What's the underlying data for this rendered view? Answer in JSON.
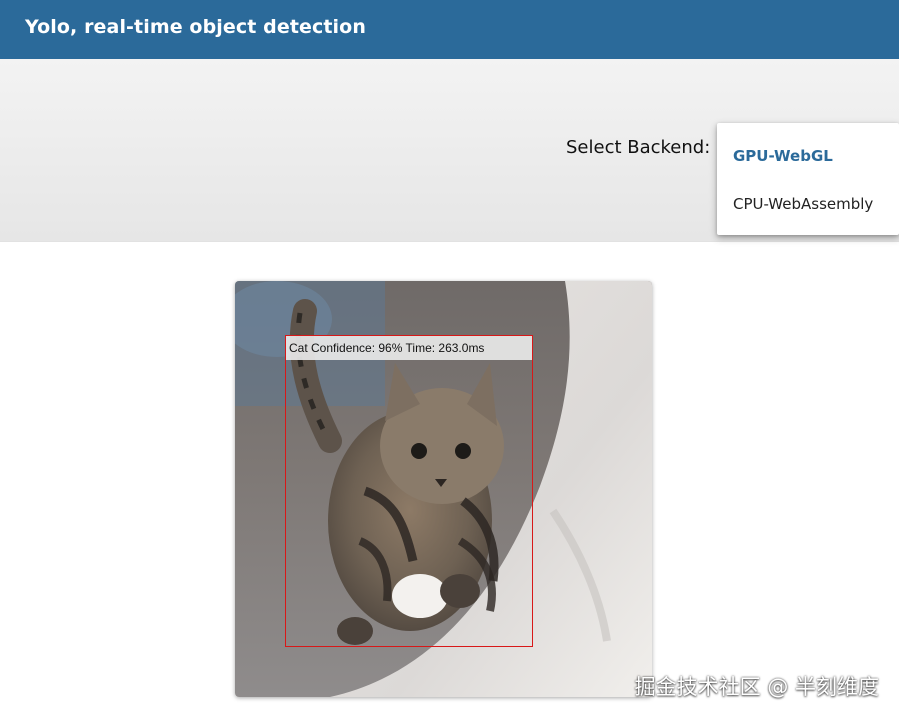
{
  "header": {
    "title": "Yolo, real-time object detection"
  },
  "backend": {
    "label": "Select Backend:",
    "options": [
      "GPU-WebGL",
      "CPU-WebAssembly"
    ],
    "selected": "GPU-WebGL"
  },
  "detection": {
    "label": "Cat Confidence: 96% Time: 263.0ms"
  },
  "watermark": "掘金技术社区 @ 半刻维度",
  "colors": {
    "header_bg": "#2b6a9a",
    "accent": "#2b6a9a",
    "box_border": "#d81818"
  }
}
